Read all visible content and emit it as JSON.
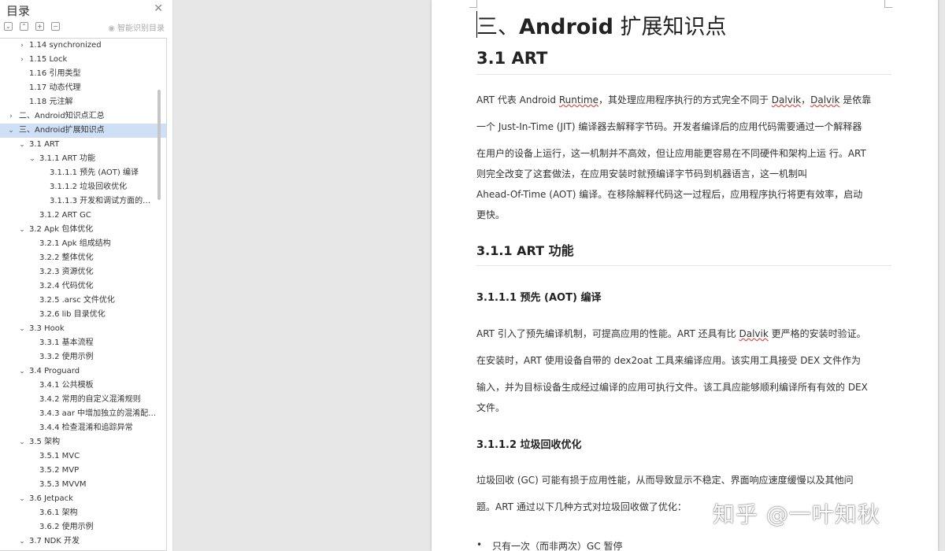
{
  "sidebar": {
    "title": "目录",
    "close_glyph": "✕",
    "smart_toc_label": "智能识别目录",
    "toc": [
      {
        "level": 2,
        "chevron": "right",
        "label": "1.14 synchronized"
      },
      {
        "level": 2,
        "chevron": "right",
        "label": "1.15 Lock"
      },
      {
        "level": 2,
        "chevron": "",
        "label": "1.16 引用类型"
      },
      {
        "level": 2,
        "chevron": "",
        "label": "1.17 动态代理"
      },
      {
        "level": 2,
        "chevron": "",
        "label": "1.18 元注解"
      },
      {
        "level": 1,
        "chevron": "right",
        "label": "二、Android知识点汇总"
      },
      {
        "level": 1,
        "chevron": "down",
        "label": "三、Android扩展知识点",
        "selected": true
      },
      {
        "level": 2,
        "chevron": "down",
        "label": "3.1 ART"
      },
      {
        "level": 3,
        "chevron": "down",
        "label": "3.1.1 ART 功能"
      },
      {
        "level": 4,
        "chevron": "",
        "label": "3.1.1.1 预先 (AOT) 编译"
      },
      {
        "level": 4,
        "chevron": "",
        "label": "3.1.1.2 垃圾回收优化"
      },
      {
        "level": 4,
        "chevron": "",
        "label": "3.1.1.3 开发和调试方面的…"
      },
      {
        "level": 3,
        "chevron": "",
        "label": "3.1.2 ART GC"
      },
      {
        "level": 2,
        "chevron": "down",
        "label": "3.2 Apk 包体优化"
      },
      {
        "level": 3,
        "chevron": "",
        "label": "3.2.1 Apk 组成结构"
      },
      {
        "level": 3,
        "chevron": "",
        "label": "3.2.2 整体优化"
      },
      {
        "level": 3,
        "chevron": "",
        "label": "3.2.3 资源优化"
      },
      {
        "level": 3,
        "chevron": "",
        "label": "3.2.4 代码优化"
      },
      {
        "level": 3,
        "chevron": "",
        "label": "3.2.5 .arsc 文件优化"
      },
      {
        "level": 3,
        "chevron": "",
        "label": "3.2.6 lib 目录优化"
      },
      {
        "level": 2,
        "chevron": "down",
        "label": "3.3 Hook"
      },
      {
        "level": 3,
        "chevron": "",
        "label": "3.3.1 基本流程"
      },
      {
        "level": 3,
        "chevron": "",
        "label": "3.3.2 使用示例"
      },
      {
        "level": 2,
        "chevron": "down",
        "label": "3.4 Proguard"
      },
      {
        "level": 3,
        "chevron": "",
        "label": "3.4.1 公共模板"
      },
      {
        "level": 3,
        "chevron": "",
        "label": "3.4.2 常用的自定义混淆规则"
      },
      {
        "level": 3,
        "chevron": "",
        "label": "3.4.3 aar 中增加独立的混淆配…"
      },
      {
        "level": 3,
        "chevron": "",
        "label": "3.4.4 检查混淆和追踪异常"
      },
      {
        "level": 2,
        "chevron": "down",
        "label": "3.5 架构"
      },
      {
        "level": 3,
        "chevron": "",
        "label": "3.5.1 MVC"
      },
      {
        "level": 3,
        "chevron": "",
        "label": "3.5.2 MVP"
      },
      {
        "level": 3,
        "chevron": "",
        "label": "3.5.3 MVVM"
      },
      {
        "level": 2,
        "chevron": "down",
        "label": "3.6 Jetpack"
      },
      {
        "level": 3,
        "chevron": "",
        "label": "3.6.1 架构"
      },
      {
        "level": 3,
        "chevron": "",
        "label": "3.6.2 使用示例"
      },
      {
        "level": 2,
        "chevron": "down",
        "label": "3.7 NDK 开发"
      }
    ]
  },
  "document": {
    "h1_prefix": "三、",
    "h1_bold": "Android",
    "h1_suffix": " 扩展知识点",
    "h2": "3.1 ART",
    "p1": [
      [
        {
          "t": "ART 代表 Android "
        },
        {
          "t": "Runtime",
          "u": true
        },
        {
          "t": "，其处理应用程序执行的方式完全不同于 "
        },
        {
          "t": "Dalvik",
          "u": true
        },
        {
          "t": "，"
        },
        {
          "t": "Dalvik",
          "u": true
        },
        {
          "t": " 是依靠"
        }
      ],
      [
        {
          "t": "一个 Just-In-Time (JIT) 编译器去解释字节码。开发者编译后的应用代码需要通过一个解释器"
        }
      ],
      [
        {
          "t": "在用户的设备上运行，这一机制并不高效，但让应用能更容易在不同硬件和架构上运 行。ART"
        }
      ],
      [
        {
          "t": "则完全改变了这套做法，在应用安装时就预编译字节码到机器语言，这一机制叫"
        }
      ],
      [
        {
          "t": "Ahead-Of-Time (AOT) 编译。在移除解释代码这一过程后，应用程序执行将更有效率，启动"
        }
      ],
      [
        {
          "t": "更快。"
        }
      ]
    ],
    "h3": "3.1.1 ART 功能",
    "h4_1": "3.1.1.1 预先 (AOT) 编译",
    "p2": [
      [
        {
          "t": "ART 引入了预先编译机制，可提高应用的性能。ART 还具有比 "
        },
        {
          "t": "Dalvik",
          "u": true
        },
        {
          "t": " 更严格的安装时验证。"
        }
      ],
      [
        {
          "t": "在安装时，ART 使用设备自带的 dex2oat 工具来编译应用。该实用工具接受 DEX 文件作为"
        }
      ],
      [
        {
          "t": "输入，并为目标设备生成经过编译的应用可执行文件。该工具应能够顺利编译所有有效的 DEX"
        }
      ],
      [
        {
          "t": "文件。"
        }
      ]
    ],
    "h4_2": "3.1.1.2 垃圾回收优化",
    "p3": [
      [
        {
          "t": "垃圾回收 (GC) 可能有损于应用性能，从而导致显示不稳定、界面响应速度缓慢以及其他问"
        }
      ],
      [
        {
          "t": "题。ART 通过以下几种方式对垃圾回收做了优化："
        }
      ]
    ],
    "bullet_1": "只有一次（而非两次）GC 暂停"
  },
  "watermark": "知乎 @一叶知秋",
  "colors": {
    "selected_row": "#cfe0f6",
    "spell_underline": "#d9534f",
    "workspace_bg": "#e7e7e7"
  }
}
